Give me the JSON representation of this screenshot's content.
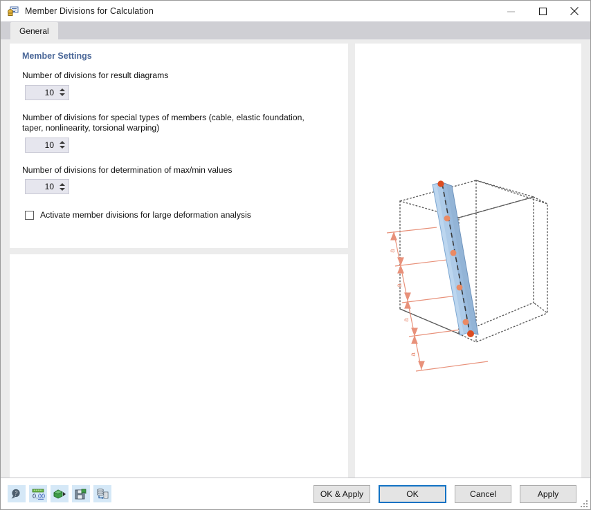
{
  "window": {
    "title": "Member Divisions for Calculation",
    "app_icon": "member-divisions-icon",
    "controls": {
      "minimize": "minimize-icon",
      "maximize": "maximize-icon",
      "close": "close-icon"
    }
  },
  "tabs": [
    {
      "label": "General",
      "active": true
    }
  ],
  "settings": {
    "group_title": "Member Settings",
    "accent_color": "#4a6798",
    "fields": [
      {
        "label": "Number of divisions for result diagrams",
        "value": "10"
      },
      {
        "label": "Number of divisions for special types of members (cable, elastic foundation, taper, nonlinearity, torsional warping)",
        "value": "10"
      },
      {
        "label": "Number of divisions for determination of max/min values",
        "value": "10"
      }
    ],
    "checkbox": {
      "label": "Activate member divisions for large deformation analysis",
      "checked": false
    }
  },
  "graphic": {
    "name": "member-divisions-3d-preview",
    "dimension_label": "a",
    "dimension_count": 4,
    "member_color": "#a8c8ea",
    "node_color": "#e0552c",
    "dimension_color": "#e8917a"
  },
  "footer": {
    "tools": [
      {
        "name": "help-magnifier-icon",
        "title": "Info"
      },
      {
        "name": "decimal-places-icon",
        "title": "0,00"
      },
      {
        "name": "import-settings-icon",
        "title": "Import"
      },
      {
        "name": "save-settings-icon",
        "title": "Save"
      },
      {
        "name": "database-export-icon",
        "title": "Export"
      }
    ],
    "buttons": {
      "ok_apply": "OK & Apply",
      "ok": "OK",
      "cancel": "Cancel",
      "apply": "Apply"
    },
    "resize_grip": "resize-grip-icon"
  }
}
